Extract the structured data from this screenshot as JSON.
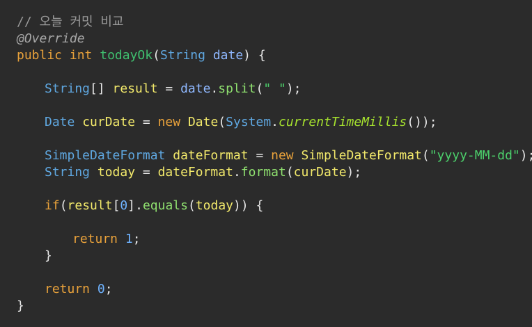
{
  "editor": {
    "lines": [
      {
        "indent": 0,
        "tokens": [
          {
            "t": "// 오늘 커밋 비교",
            "k": "comment"
          }
        ]
      },
      {
        "indent": 0,
        "tokens": [
          {
            "t": "@Override",
            "k": "annot"
          }
        ]
      },
      {
        "indent": 0,
        "tokens": [
          {
            "t": "public",
            "k": "keyword"
          },
          {
            "t": " ",
            "k": "plain"
          },
          {
            "t": "int",
            "k": "keyword"
          },
          {
            "t": " ",
            "k": "plain"
          },
          {
            "t": "todayOk",
            "k": "method"
          },
          {
            "t": "(",
            "k": "punct"
          },
          {
            "t": "String",
            "k": "type"
          },
          {
            "t": " ",
            "k": "plain"
          },
          {
            "t": "date",
            "k": "param"
          },
          {
            "t": ") {",
            "k": "punct"
          }
        ]
      },
      {
        "indent": 0,
        "tokens": []
      },
      {
        "indent": 1,
        "tokens": [
          {
            "t": "String",
            "k": "type"
          },
          {
            "t": "[] ",
            "k": "punct"
          },
          {
            "t": "result",
            "k": "var"
          },
          {
            "t": " = ",
            "k": "punct"
          },
          {
            "t": "date",
            "k": "param"
          },
          {
            "t": ".",
            "k": "punct"
          },
          {
            "t": "split",
            "k": "call"
          },
          {
            "t": "(",
            "k": "punct"
          },
          {
            "t": "\" \"",
            "k": "string"
          },
          {
            "t": ");",
            "k": "punct"
          }
        ]
      },
      {
        "indent": 0,
        "tokens": []
      },
      {
        "indent": 1,
        "tokens": [
          {
            "t": "Date",
            "k": "type"
          },
          {
            "t": " ",
            "k": "plain"
          },
          {
            "t": "curDate",
            "k": "var"
          },
          {
            "t": " = ",
            "k": "punct"
          },
          {
            "t": "new",
            "k": "new"
          },
          {
            "t": " ",
            "k": "plain"
          },
          {
            "t": "Date",
            "k": "class2"
          },
          {
            "t": "(",
            "k": "punct"
          },
          {
            "t": "System",
            "k": "type"
          },
          {
            "t": ".",
            "k": "punct"
          },
          {
            "t": "currentTimeMillis",
            "k": "static"
          },
          {
            "t": "());",
            "k": "punct"
          }
        ]
      },
      {
        "indent": 0,
        "tokens": []
      },
      {
        "indent": 1,
        "tokens": [
          {
            "t": "SimpleDateFormat",
            "k": "type"
          },
          {
            "t": " ",
            "k": "plain"
          },
          {
            "t": "dateFormat",
            "k": "var"
          },
          {
            "t": " = ",
            "k": "punct"
          },
          {
            "t": "new",
            "k": "new"
          },
          {
            "t": " ",
            "k": "plain"
          },
          {
            "t": "SimpleDateFormat",
            "k": "class2"
          },
          {
            "t": "(",
            "k": "punct"
          },
          {
            "t": "\"yyyy-MM-dd\"",
            "k": "string"
          },
          {
            "t": ");",
            "k": "punct"
          }
        ]
      },
      {
        "indent": 1,
        "tokens": [
          {
            "t": "String",
            "k": "type"
          },
          {
            "t": " ",
            "k": "plain"
          },
          {
            "t": "today",
            "k": "var"
          },
          {
            "t": " = ",
            "k": "punct"
          },
          {
            "t": "dateFormat",
            "k": "var"
          },
          {
            "t": ".",
            "k": "punct"
          },
          {
            "t": "format",
            "k": "call"
          },
          {
            "t": "(",
            "k": "punct"
          },
          {
            "t": "curDate",
            "k": "var"
          },
          {
            "t": ");",
            "k": "punct"
          }
        ]
      },
      {
        "indent": 0,
        "tokens": []
      },
      {
        "indent": 1,
        "tokens": [
          {
            "t": "if",
            "k": "keyword"
          },
          {
            "t": "(",
            "k": "punct"
          },
          {
            "t": "result",
            "k": "var"
          },
          {
            "t": "[",
            "k": "punct"
          },
          {
            "t": "0",
            "k": "number"
          },
          {
            "t": "].",
            "k": "punct"
          },
          {
            "t": "equals",
            "k": "call"
          },
          {
            "t": "(",
            "k": "punct"
          },
          {
            "t": "today",
            "k": "var"
          },
          {
            "t": ")) {",
            "k": "punct"
          }
        ]
      },
      {
        "indent": 0,
        "tokens": []
      },
      {
        "indent": 2,
        "tokens": [
          {
            "t": "return",
            "k": "keyword"
          },
          {
            "t": " ",
            "k": "plain"
          },
          {
            "t": "1",
            "k": "number"
          },
          {
            "t": ";",
            "k": "punct"
          }
        ]
      },
      {
        "indent": 1,
        "tokens": [
          {
            "t": "}",
            "k": "punct"
          }
        ]
      },
      {
        "indent": 0,
        "tokens": []
      },
      {
        "indent": 1,
        "tokens": [
          {
            "t": "return",
            "k": "keyword"
          },
          {
            "t": " ",
            "k": "plain"
          },
          {
            "t": "0",
            "k": "number"
          },
          {
            "t": ";",
            "k": "punct"
          }
        ]
      },
      {
        "indent": 0,
        "tokens": [
          {
            "t": "}",
            "k": "punct"
          }
        ]
      }
    ]
  },
  "colors": {
    "background": "#2b2b2b",
    "comment": "#9a9a9a",
    "keyword": "#e9a23b",
    "type": "#5fa7e0",
    "method": "#3fbf6f",
    "variable": "#f2e96b",
    "string": "#4cd06b",
    "number": "#6fb3ff",
    "static_method": "#a6e22e"
  }
}
